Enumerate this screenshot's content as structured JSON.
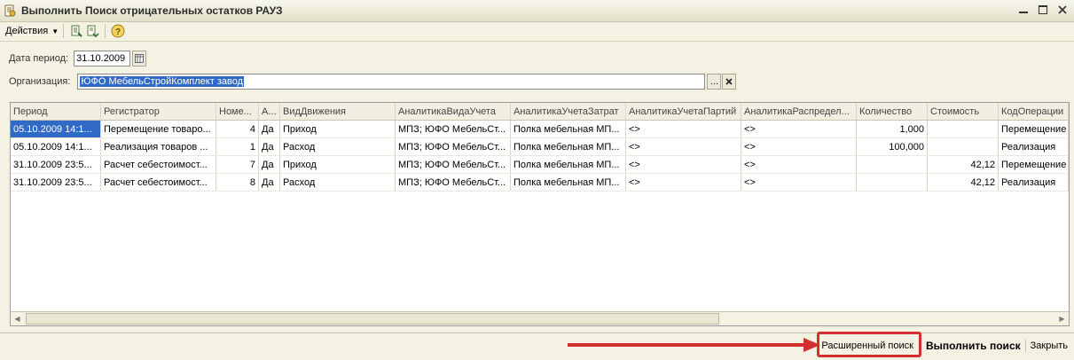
{
  "window": {
    "title": "Выполнить  Поиск отрицательных остатков РАУЗ",
    "icon": "document-icon",
    "controls": [
      "minimize",
      "maximize",
      "close"
    ]
  },
  "toolbar": {
    "actions_label": "Действия",
    "icons": [
      "refresh-icon",
      "export-icon",
      "help-icon"
    ]
  },
  "form": {
    "date_label": "Дата период:",
    "date_value": "31.10.2009",
    "org_label": "Организация:",
    "org_value": "ЮФО МебельСтройКомплект завод"
  },
  "table": {
    "columns": [
      "Период",
      "Регистратор",
      "Номе...",
      "А...",
      "ВидДвижения",
      "АналитикаВидаУчета",
      "АналитикаУчетаЗатрат",
      "АналитикаУчетаПартий",
      "АналитикаРаспредел...",
      "Количество",
      "Стоимость",
      "КодОперации"
    ],
    "rows": [
      [
        "05.10.2009 14:1...",
        "Перемещение товаро...",
        "4",
        "Да",
        "Приход",
        "МПЗ; ЮФО МебельСт...",
        "Полка мебельная МП...",
        "<>",
        "<>",
        "1,000",
        "",
        "Перемещение"
      ],
      [
        "05.10.2009 14:1...",
        "Реализация товаров ...",
        "1",
        "Да",
        "Расход",
        "МПЗ; ЮФО МебельСт...",
        "Полка мебельная МП...",
        "<>",
        "<>",
        "100,000",
        "",
        "Реализация"
      ],
      [
        "31.10.2009 23:5...",
        "Расчет себестоимост...",
        "7",
        "Да",
        "Приход",
        "МПЗ; ЮФО МебельСт...",
        "Полка мебельная МП...",
        "<>",
        "<>",
        "",
        "42,12",
        "Перемещение"
      ],
      [
        "31.10.2009 23:5...",
        "Расчет себестоимост...",
        "8",
        "Да",
        "Расход",
        "МПЗ; ЮФО МебельСт...",
        "Полка мебельная МП...",
        "<>",
        "<>",
        "",
        "42,12",
        "Реализация"
      ]
    ]
  },
  "footer": {
    "advanced_search": "Расширенный поиск",
    "run_search": "Выполнить поиск",
    "close": "Закрыть"
  },
  "colors": {
    "highlight": "#d32f2f",
    "selection": "#3169c6"
  }
}
